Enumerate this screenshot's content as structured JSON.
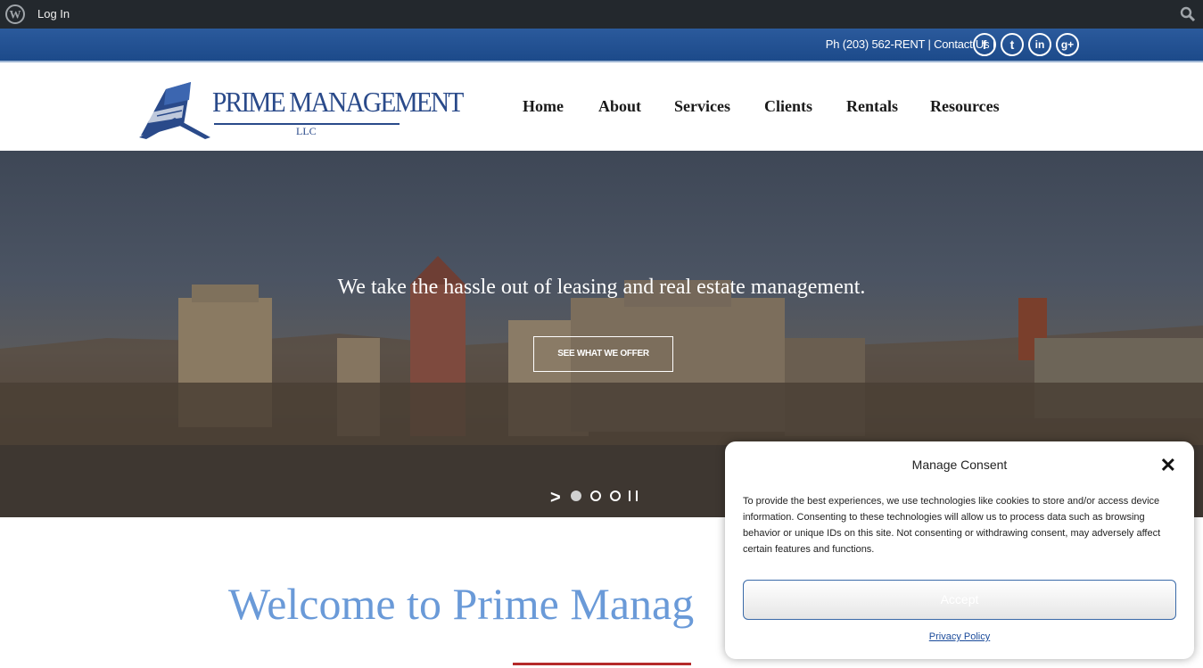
{
  "adminbar": {
    "login_label": "Log In"
  },
  "topbar": {
    "phone": "Ph (203) 562-RENT",
    "separator": "|",
    "contact_label": "Contact Us",
    "social": [
      {
        "label": "f",
        "icon": "facebook-icon"
      },
      {
        "label": "t",
        "icon": "twitter-icon"
      },
      {
        "label": "in",
        "icon": "linkedin-icon"
      },
      {
        "label": "g+",
        "icon": "google-plus-icon"
      }
    ]
  },
  "logo": {
    "name": "PRIME MANAGEMENT",
    "suffix": "LLC"
  },
  "nav": {
    "items": [
      {
        "label": "Home"
      },
      {
        "label": "About"
      },
      {
        "label": "Services"
      },
      {
        "label": "Clients"
      },
      {
        "label": "Rentals"
      },
      {
        "label": "Resources"
      }
    ]
  },
  "hero": {
    "tagline": "We take the hassle out of leasing and real estate management.",
    "button_label": "SEE WHAT WE OFFER",
    "slides_total": 3,
    "active_slide": 1
  },
  "welcome": {
    "heading": "Welcome to Prime Manag"
  },
  "consent": {
    "title": "Manage Consent",
    "body": "To provide the best experiences, we use technologies like cookies to store and/or access device information. Consenting to these technologies will allow us to process data such as browsing behavior or unique IDs on this site. Not consenting or withdrawing consent, may adversely affect certain features and functions.",
    "accept_label": "Accept",
    "privacy_label": "Privacy Policy"
  },
  "colors": {
    "adminbar": "#23282d",
    "topbar": "#1c4a8a",
    "brand": "#2a4a8a",
    "welcome": "#6a9ad8",
    "accent_line": "#b52a2a"
  }
}
